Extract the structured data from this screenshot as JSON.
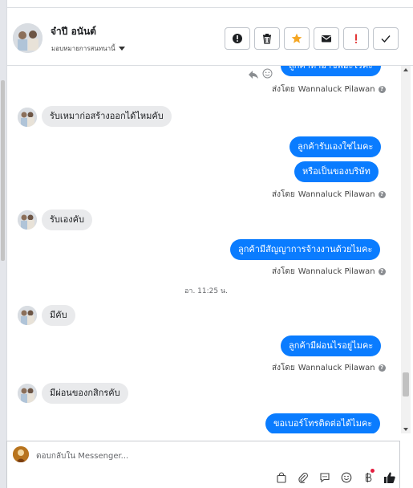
{
  "header": {
    "contact_name": "จ๋าปี อนันต์",
    "assign_label": "มอบหมายการสนทนานี้",
    "actions": [
      {
        "icon": "alert-circle-icon"
      },
      {
        "icon": "trash-icon"
      },
      {
        "icon": "star-icon"
      },
      {
        "icon": "envelope-icon"
      },
      {
        "icon": "exclamation-icon"
      },
      {
        "icon": "checkmark-icon"
      }
    ]
  },
  "chat": {
    "top_partial": "ลูกค้าทำอาชีพอะไรคะ",
    "sent_by_prefix": "ส่งโดย",
    "agent": "Wannaluck Pilawan",
    "msg1": "รับเหมาก่อสร้างออกได้ไหมคับ",
    "msg2": "ลูกค้ารับเองใช่ไมคะ",
    "msg3": "หรือเป็นของบริษัท",
    "msg4": "รับเองคับ",
    "msg5": "ลูกค้ามีสัญญาการจ้างงานด้วยไมคะ",
    "timestamp": "อา. 11:25 น.",
    "msg6": "มีคับ",
    "msg7": "ลูกค้ามีผ่อนไรอยู่ไมคะ",
    "msg8": "มีผ่อนของกสิกรคับ",
    "msg9": "ขอเบอร์โทรติดต่อได้ไมคะ"
  },
  "composer": {
    "placeholder": "ตอบกลับใน Messenger..."
  },
  "colors": {
    "outgoing_bubble": "#0a7cff",
    "incoming_bubble": "#e9eaec",
    "star": "#f5a623",
    "exclamation": "#e02020"
  }
}
